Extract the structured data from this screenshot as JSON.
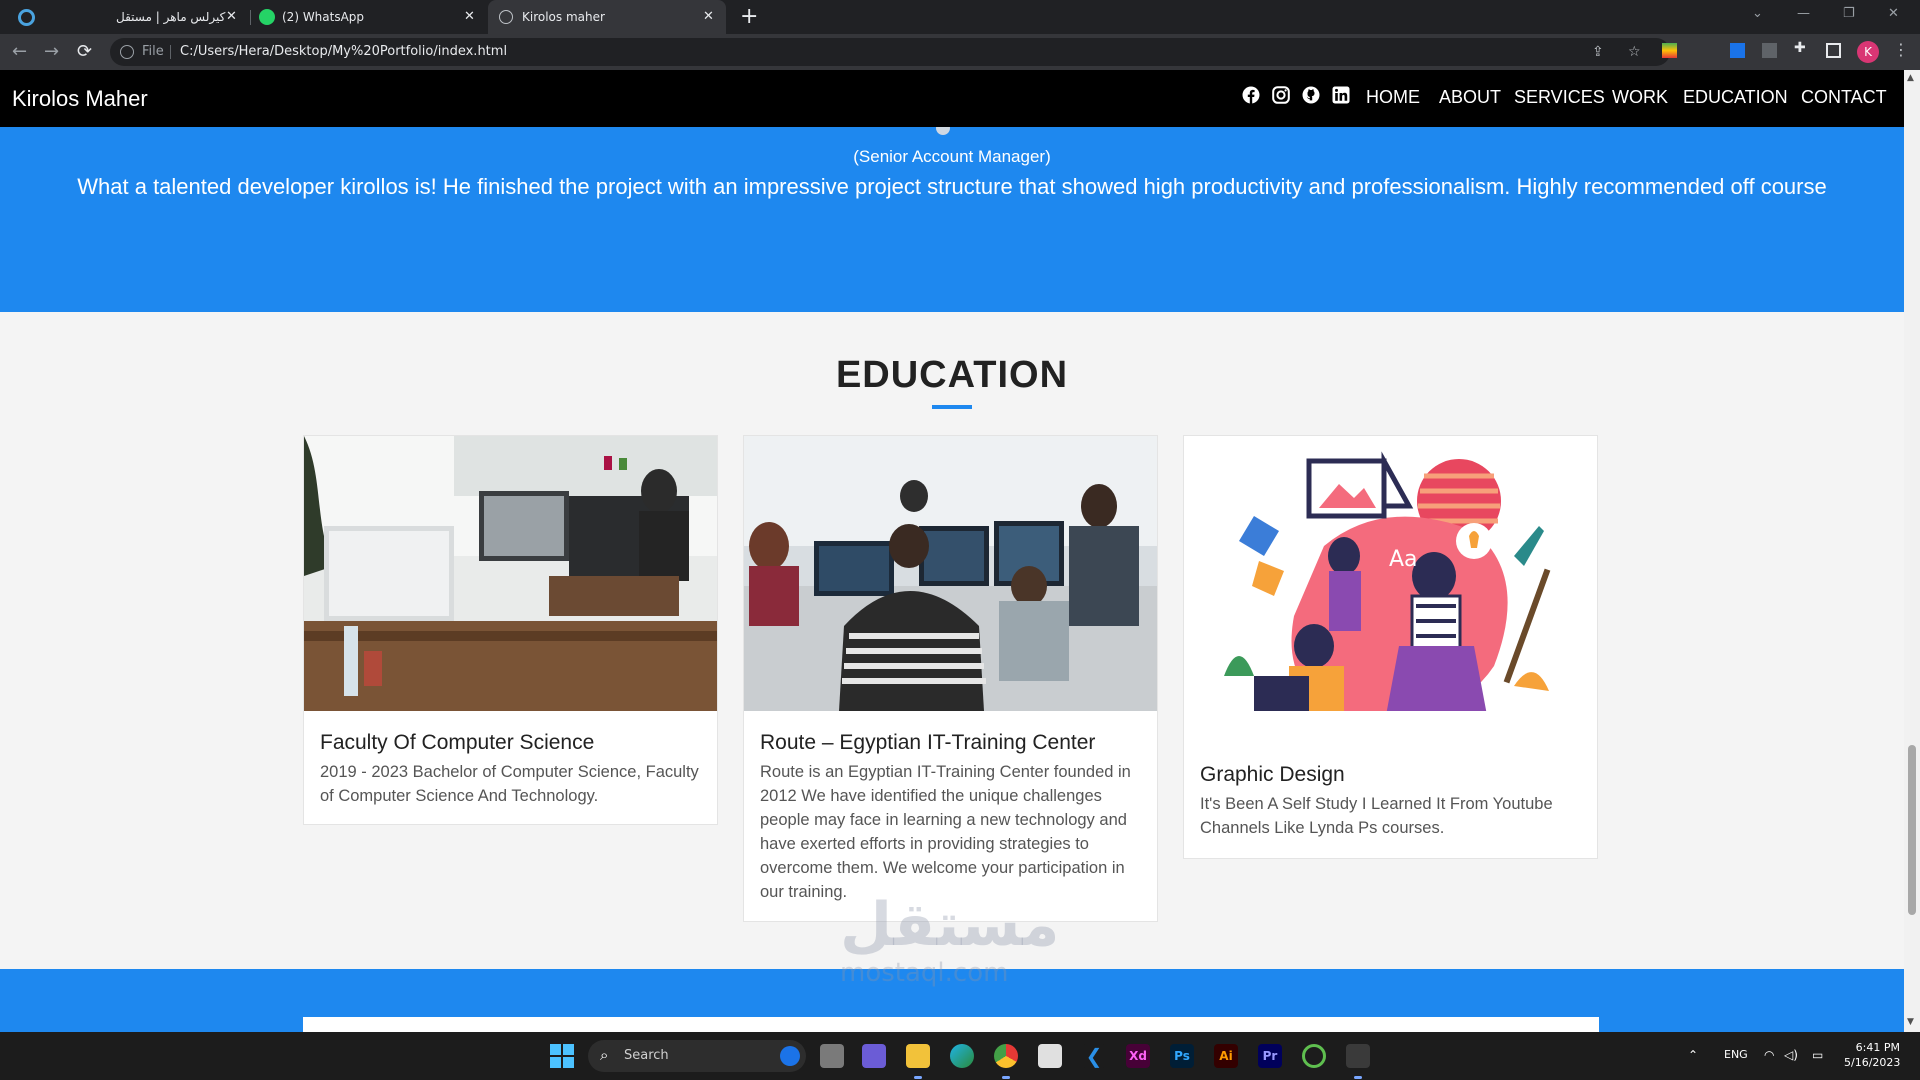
{
  "browser": {
    "tabs": [
      {
        "label": "كيرلس ماهر | مستقل",
        "close": "✕"
      },
      {
        "label": "(2) WhatsApp",
        "close": "✕"
      },
      {
        "label": "Kirolos maher",
        "close": "✕"
      }
    ],
    "new_tab": "+",
    "window_controls": {
      "minimize": "—",
      "restore": "❐",
      "close": "✕",
      "tab_search": "⌄"
    },
    "nav": {
      "back": "←",
      "forward": "→",
      "reload": "⟳"
    },
    "address": {
      "scheme_label": "File",
      "url": "C:/Users/Hera/Desktop/My%20Portfolio/index.html"
    },
    "profile_initial": "K"
  },
  "site": {
    "brand": "Kirolos Maher",
    "menu": [
      "HOME",
      "ABOUT",
      "SERVICES",
      "WORK",
      "EDUCATION",
      "CONTACT"
    ],
    "social_icons": [
      "facebook-icon",
      "instagram-icon",
      "github-icon",
      "linkedin-icon"
    ]
  },
  "testimonial": {
    "role": "(Senior Account Manager)",
    "quote": "What a talented developer kirollos is! He finished the project with an impressive project structure that showed high productivity and professionalism. Highly recommended off course"
  },
  "education": {
    "title": "EDUCATION",
    "cards": [
      {
        "title": "Faculty Of Computer Science",
        "text": "2019 - 2023 Bachelor of Computer Science, Faculty of Computer Science And Technology."
      },
      {
        "title": "Route – Egyptian IT-Training Center",
        "text": "Route is an Egyptian IT-Training Center founded in 2012 We have identified the unique challenges people may face in learning a new technology and have exerted efforts in providing strategies to overcome them. We welcome your participation in our training."
      },
      {
        "title": "Graphic Design",
        "text": "It's Been A Self Study I Learned It From Youtube Channels Like Lynda Ps courses."
      }
    ]
  },
  "watermark": {
    "main": "مستقل",
    "sub": "mostaql.com"
  },
  "taskbar": {
    "search_label": "Search",
    "apps": [
      "Xd",
      "Ps",
      "Ai",
      "Pr"
    ],
    "language": "ENG",
    "time": "6:41 PM",
    "date": "5/16/2023"
  },
  "colors": {
    "accent": "#1e88ef",
    "nav_bg": "#000000",
    "page_bg": "#f4f4f4"
  }
}
